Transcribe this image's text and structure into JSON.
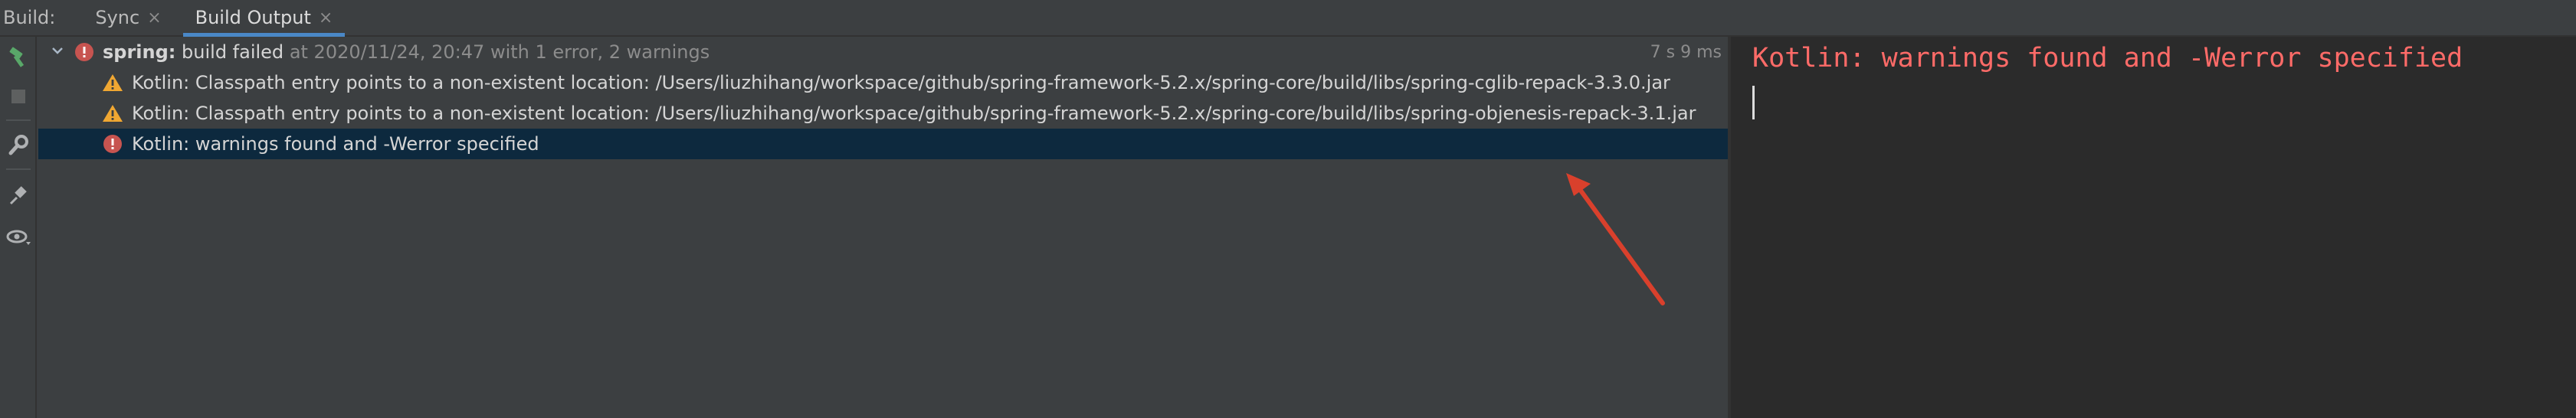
{
  "toolwindow": {
    "label": "Build:",
    "tabs": [
      {
        "label": "Sync",
        "close": "×"
      },
      {
        "label": "Build Output",
        "close": "×"
      }
    ]
  },
  "tree": {
    "root": {
      "project": "spring:",
      "status": "build failed",
      "detail": "at 2020/11/24, 20:47 with 1 error, 2 warnings",
      "duration": "7 s 9 ms"
    },
    "messages": [
      {
        "type": "warning",
        "text": "Kotlin: Classpath entry points to a non-existent location: /Users/liuzhihang/workspace/github/spring-framework-5.2.x/spring-core/build/libs/spring-cglib-repack-3.3.0.jar"
      },
      {
        "type": "warning",
        "text": "Kotlin: Classpath entry points to a non-existent location: /Users/liuzhihang/workspace/github/spring-framework-5.2.x/spring-core/build/libs/spring-objenesis-repack-3.1.jar"
      },
      {
        "type": "error",
        "text": "Kotlin: warnings found and -Werror specified"
      }
    ]
  },
  "console": {
    "message": "Kotlin: warnings found and -Werror specified"
  },
  "colors": {
    "error": "#c75450",
    "warning": "#f0a732",
    "console_error_text": "#ff6b68",
    "selection": "#0d293e",
    "annotation_arrow": "#d9402c"
  }
}
